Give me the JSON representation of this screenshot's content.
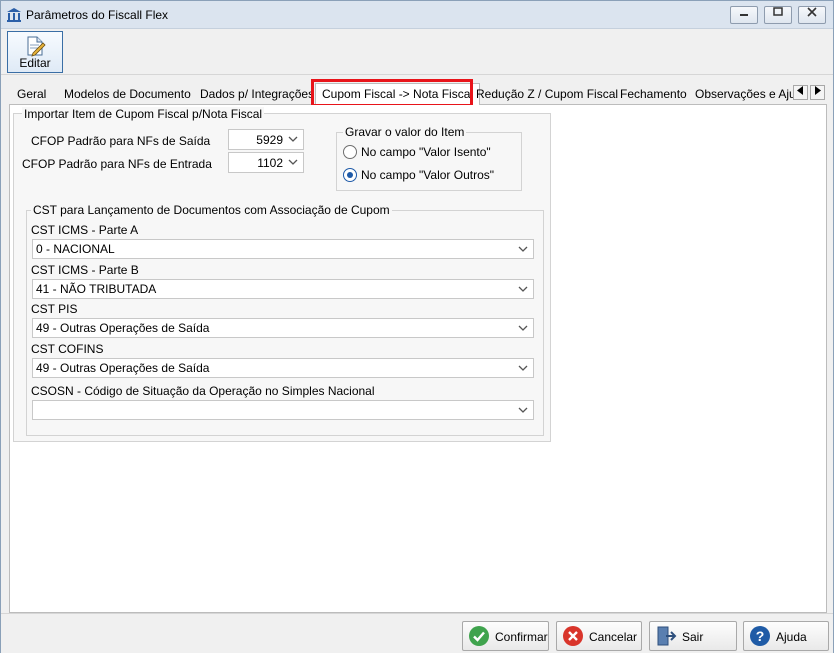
{
  "window": {
    "title": "Parâmetros do Fiscall Flex"
  },
  "toolbar": {
    "edit_label": "Editar"
  },
  "tabs": [
    {
      "label": "Geral"
    },
    {
      "label": "Modelos de Documento"
    },
    {
      "label": "Dados p/ Integrações"
    },
    {
      "label": "Cupom Fiscal -> Nota Fiscal"
    },
    {
      "label": "Redução Z / Cupom Fiscal"
    },
    {
      "label": "Fechamento"
    },
    {
      "label": "Observações e Ajus"
    }
  ],
  "import_panel": {
    "title": "Importar Item de Cupom Fiscal p/Nota Fiscal",
    "cfop_saida_label": "CFOP Padrão para NFs de Saída",
    "cfop_saida_value": "5929",
    "cfop_entrada_label": "CFOP Padrão para NFs de Entrada",
    "cfop_entrada_value": "1102"
  },
  "gravar": {
    "title": "Gravar o valor do Item",
    "option_isento": "No campo \"Valor Isento\"",
    "option_outros": "No campo \"Valor Outros\"",
    "selected": "outros"
  },
  "cst_panel": {
    "title": "CST para Lançamento de Documentos com Associação de Cupom",
    "fields": [
      {
        "label": "CST ICMS - Parte A",
        "value": "0 - NACIONAL"
      },
      {
        "label": "CST ICMS - Parte B",
        "value": "41 - NÃO TRIBUTADA"
      },
      {
        "label": "CST PIS",
        "value": "49 - Outras Operações de Saída"
      },
      {
        "label": "CST COFINS",
        "value": "49 - Outras Operações de Saída"
      },
      {
        "label": "CSOSN - Código de Situação da Operação no Simples Nacional",
        "value": ""
      }
    ]
  },
  "footer": {
    "confirm": "Confirmar",
    "cancel": "Cancelar",
    "exit": "Sair",
    "help": "Ajuda"
  },
  "colors": {
    "active_tab_highlight": "#e8141a",
    "radio_selected": "#1e5aa8",
    "confirm_icon": "#3fa34d",
    "cancel_icon": "#d9352b",
    "help_icon": "#1f5ba6"
  }
}
